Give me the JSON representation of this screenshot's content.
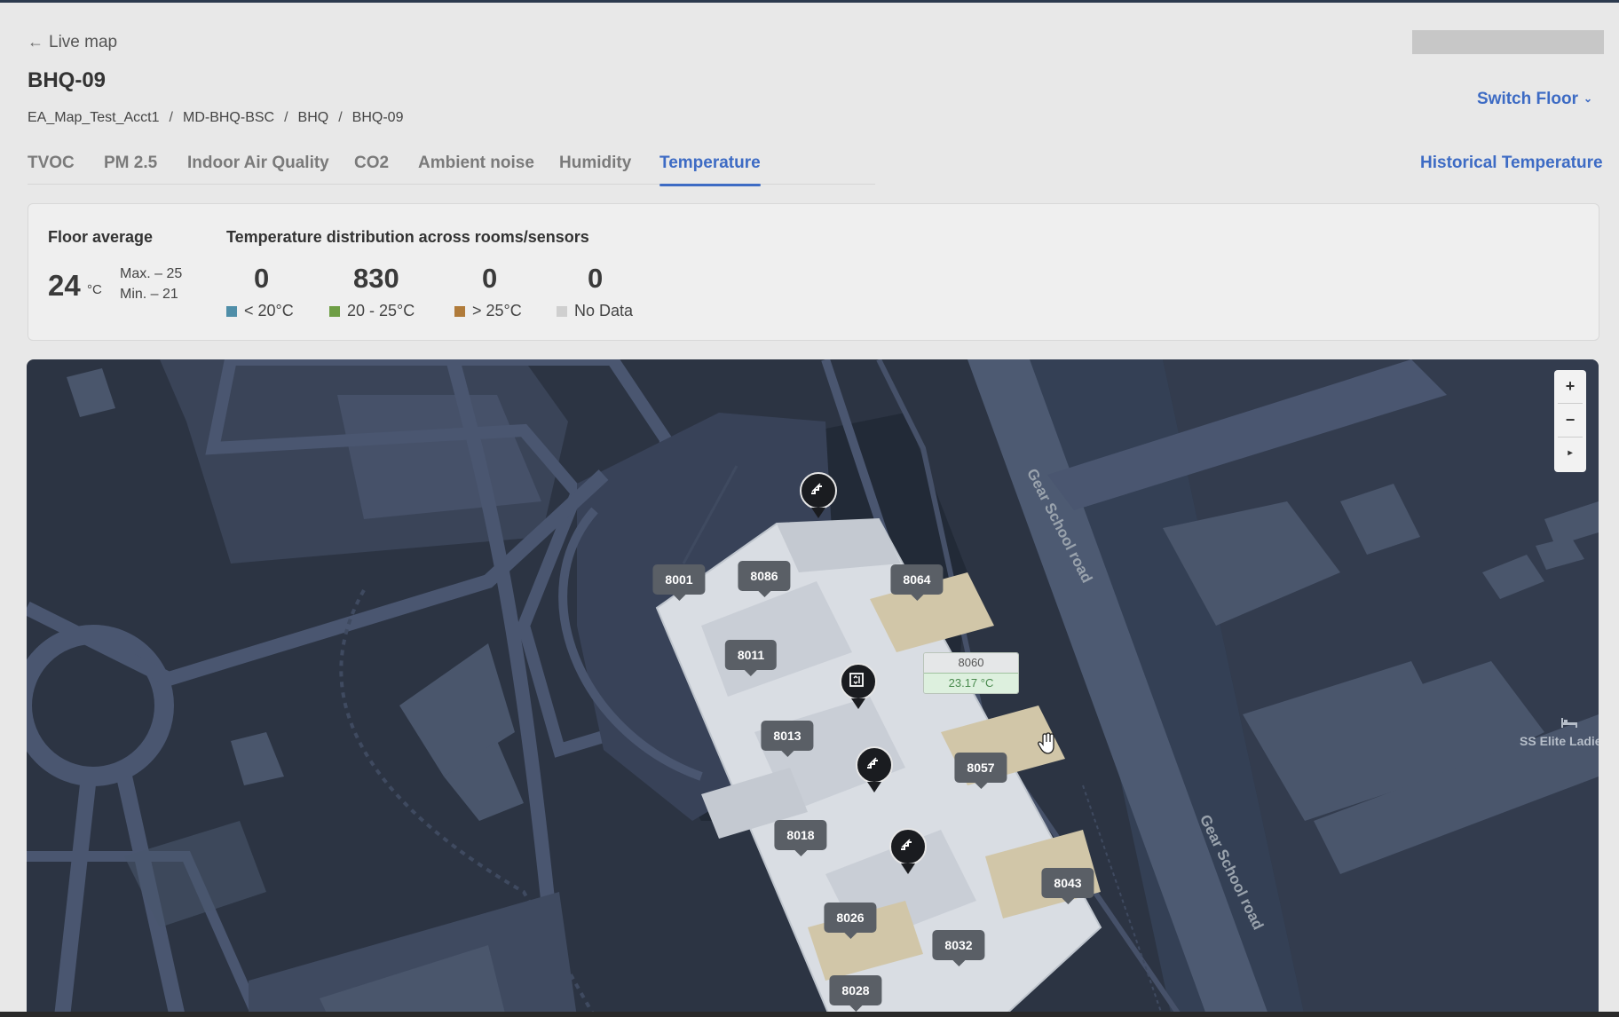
{
  "header": {
    "back_label": "Live map",
    "title": "BHQ-09",
    "breadcrumbs": [
      "EA_Map_Test_Acct1",
      "MD-BHQ-BSC",
      "BHQ",
      "BHQ-09"
    ],
    "switch_floor": "Switch Floor",
    "historical_link": "Historical Temperature"
  },
  "tabs": [
    {
      "label": "TVOC",
      "active": false
    },
    {
      "label": "PM 2.5",
      "active": false
    },
    {
      "label": "Indoor Air Quality",
      "active": false
    },
    {
      "label": "CO2",
      "active": false
    },
    {
      "label": "Ambient noise",
      "active": false
    },
    {
      "label": "Humidity",
      "active": false
    },
    {
      "label": "Temperature",
      "active": true
    }
  ],
  "stats": {
    "floor_average_label": "Floor average",
    "floor_average_value": "24",
    "unit": "°C",
    "max": "Max. –  25",
    "min": "Min. –  21",
    "distribution_label": "Temperature distribution across rooms/sensors",
    "distribution": [
      {
        "count": "0",
        "label": "< 20°C",
        "color": "#4f8ea8"
      },
      {
        "count": "830",
        "label": "20 - 25°C",
        "color": "#6e9e45"
      },
      {
        "count": "0",
        "label": "> 25°C",
        "color": "#b07b3a"
      },
      {
        "count": "0",
        "label": "No Data",
        "color": "#cfcfcf"
      }
    ]
  },
  "map": {
    "rooms": [
      "8001",
      "8086",
      "8064",
      "8011",
      "8013",
      "8057",
      "8018",
      "8043",
      "8026",
      "8032",
      "8028"
    ],
    "tooltip": {
      "room": "8060",
      "value": "23.17 °C"
    },
    "zoom": {
      "in": "+",
      "out": "−",
      "reset": "▸"
    },
    "road_name": "Gear School road",
    "poi_label": "SS Elite Ladie",
    "pin_icons": [
      "stairs-icon",
      "elevator-icon",
      "stairs-icon",
      "stairs-icon"
    ]
  }
}
